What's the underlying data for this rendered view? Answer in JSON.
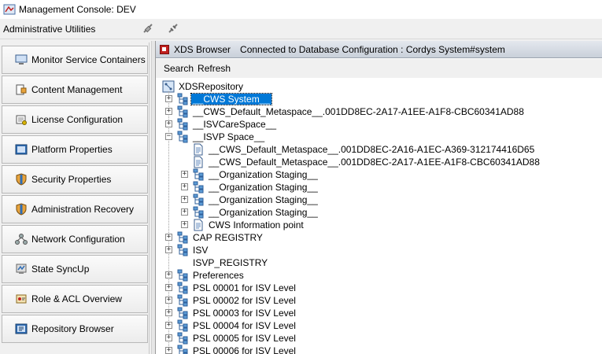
{
  "window": {
    "title": "Management Console: DEV"
  },
  "admin": {
    "label": "Administrative Utilities"
  },
  "nav": {
    "items": [
      {
        "label": "Monitor Service Containers",
        "icon": "monitor-icon"
      },
      {
        "label": "Content Management",
        "icon": "content-icon"
      },
      {
        "label": "License Configuration",
        "icon": "license-icon"
      },
      {
        "label": "Platform Properties",
        "icon": "platform-icon"
      },
      {
        "label": "Security Properties",
        "icon": "shield-icon"
      },
      {
        "label": "Administration Recovery",
        "icon": "shield-icon"
      },
      {
        "label": "Network Configuration",
        "icon": "network-icon"
      },
      {
        "label": "State SyncUp",
        "icon": "sync-icon"
      },
      {
        "label": "Role & ACL Overview",
        "icon": "role-icon"
      },
      {
        "label": "Repository Browser",
        "icon": "repository-icon"
      }
    ]
  },
  "panel": {
    "title": "XDS Browser",
    "status": "Connected to Database Configuration : Cordys System#system"
  },
  "toolbar": {
    "search_label": "Search",
    "refresh_label": "Refresh"
  },
  "tree": {
    "root": "XDSRepository",
    "nodes": [
      {
        "label": "__CWS System__",
        "level": 1,
        "expandable": true,
        "expanded": false,
        "selected": true,
        "icon": "folder-tree-icon"
      },
      {
        "label": "__CWS_Default_Metaspace__.001DD8EC-2A17-A1EE-A1F8-CBC60341AD88",
        "level": 1,
        "expandable": true,
        "expanded": false,
        "icon": "folder-tree-icon"
      },
      {
        "label": "__ISVCareSpace__",
        "level": 1,
        "expandable": true,
        "expanded": false,
        "icon": "folder-tree-icon"
      },
      {
        "label": "__ISVP Space__",
        "level": 1,
        "expandable": true,
        "expanded": true,
        "icon": "folder-tree-icon"
      },
      {
        "label": "__CWS_Default_Metaspace__.001DD8EC-2A16-A1EC-A369-312174416D65",
        "level": 2,
        "expandable": false,
        "icon": "document-icon"
      },
      {
        "label": "__CWS_Default_Metaspace__.001DD8EC-2A17-A1EE-A1F8-CBC60341AD88",
        "level": 2,
        "expandable": false,
        "icon": "document-icon"
      },
      {
        "label": "__Organization Staging__",
        "level": 2,
        "expandable": true,
        "expanded": false,
        "icon": "folder-tree-icon"
      },
      {
        "label": "__Organization Staging__",
        "level": 2,
        "expandable": true,
        "expanded": false,
        "icon": "folder-tree-icon"
      },
      {
        "label": "__Organization Staging__",
        "level": 2,
        "expandable": true,
        "expanded": false,
        "icon": "folder-tree-icon"
      },
      {
        "label": "__Organization Staging__",
        "level": 2,
        "expandable": true,
        "expanded": false,
        "icon": "folder-tree-icon"
      },
      {
        "label": "CWS Information point",
        "level": 2,
        "expandable": true,
        "expanded": false,
        "icon": "document-icon"
      },
      {
        "label": "CAP REGISTRY",
        "level": 1,
        "expandable": true,
        "expanded": false,
        "icon": "folder-tree-icon"
      },
      {
        "label": "ISV",
        "level": 1,
        "expandable": true,
        "expanded": false,
        "icon": "folder-tree-icon"
      },
      {
        "label": "ISVP_REGISTRY",
        "level": 1,
        "expandable": false,
        "icon": "none"
      },
      {
        "label": "Preferences",
        "level": 1,
        "expandable": true,
        "expanded": false,
        "icon": "folder-tree-icon"
      },
      {
        "label": "PSL 00001 for ISV Level",
        "level": 1,
        "expandable": true,
        "expanded": false,
        "icon": "folder-tree-icon"
      },
      {
        "label": "PSL 00002 for ISV Level",
        "level": 1,
        "expandable": true,
        "expanded": false,
        "icon": "folder-tree-icon"
      },
      {
        "label": "PSL 00003 for ISV Level",
        "level": 1,
        "expandable": true,
        "expanded": false,
        "icon": "folder-tree-icon"
      },
      {
        "label": "PSL 00004 for ISV Level",
        "level": 1,
        "expandable": true,
        "expanded": false,
        "icon": "folder-tree-icon"
      },
      {
        "label": "PSL 00005 for ISV Level",
        "level": 1,
        "expandable": true,
        "expanded": false,
        "icon": "folder-tree-icon"
      },
      {
        "label": "PSL 00006 for ISV Level",
        "level": 1,
        "expandable": true,
        "expanded": false,
        "icon": "folder-tree-icon"
      }
    ]
  },
  "colors": {
    "selection": "#0078d7",
    "panel_header": "#c9d0da",
    "accent_red": "#c0201f"
  }
}
